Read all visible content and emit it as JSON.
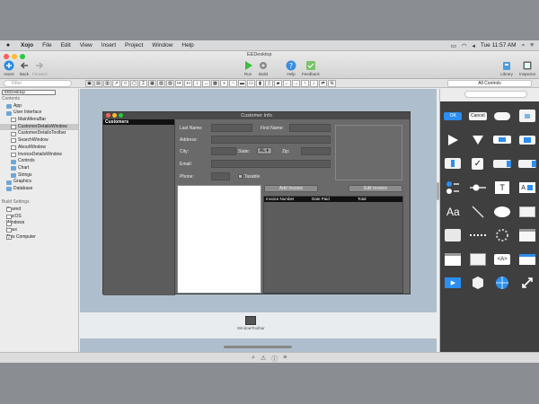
{
  "menubar": {
    "apple": "",
    "items": [
      "Xojo",
      "File",
      "Edit",
      "View",
      "Insert",
      "Project",
      "Window",
      "Help"
    ],
    "clock": "Tue 11:57 AM"
  },
  "window": {
    "tab_title": "EEDesktop",
    "toolbar": {
      "insert": "Insert",
      "back": "Back",
      "forward": "Forward",
      "run": "Run",
      "build": "Build",
      "help": "Help",
      "feedback": "Feedback",
      "library": "Library",
      "inspector": "Inspector"
    },
    "filter_placeholder": "Filter"
  },
  "navigator": {
    "rows": [
      {
        "label": "EEDesktop",
        "type": "hdrbox",
        "indent": 0
      },
      {
        "label": "Contents",
        "type": "header",
        "indent": 0
      },
      {
        "label": "App",
        "type": "folder",
        "indent": 1
      },
      {
        "label": "User Interface",
        "type": "folder",
        "indent": 1
      },
      {
        "label": "MainMenuBar",
        "type": "win",
        "indent": 2
      },
      {
        "label": "CustomerDetailsWindow",
        "type": "win",
        "indent": 2,
        "selected": true
      },
      {
        "label": "CustomerDetailsToolbar",
        "type": "win",
        "indent": 2
      },
      {
        "label": "SearchWindow",
        "type": "win",
        "indent": 2
      },
      {
        "label": "AboutWindow",
        "type": "win",
        "indent": 2
      },
      {
        "label": "InvoiceDetailsWindow",
        "type": "win",
        "indent": 2
      },
      {
        "label": "Controls",
        "type": "folder",
        "indent": 2
      },
      {
        "label": "Chart",
        "type": "folder",
        "indent": 2
      },
      {
        "label": "Strings",
        "type": "folder",
        "indent": 2
      },
      {
        "label": "Graphics",
        "type": "folder",
        "indent": 1
      },
      {
        "label": "Database",
        "type": "folder",
        "indent": 1
      },
      {
        "label": "",
        "type": "spacer",
        "indent": 0
      },
      {
        "label": "Build Settings",
        "type": "header",
        "indent": 0
      },
      {
        "label": "Shared",
        "type": "chk",
        "indent": 1
      },
      {
        "label": "macOS",
        "type": "chk",
        "indent": 1
      },
      {
        "label": "Windows",
        "type": "chk",
        "indent": 1
      },
      {
        "label": "Linux",
        "type": "chk",
        "indent": 1
      },
      {
        "label": "This Computer",
        "type": "chk",
        "indent": 1,
        "checked": true
      }
    ]
  },
  "designer": {
    "window_title": "Customer Info",
    "list_header": "Customers",
    "labels": {
      "last_name": "Last Name:",
      "first_name": "First Name:",
      "address": "Address:",
      "city": "City:",
      "state": "State:",
      "zip": "Zip:",
      "email": "Email:",
      "phone": "Phone:",
      "taxable": "Taxable"
    },
    "state_value": "AL",
    "add_invoice": "Add Invoice",
    "edit_invoice": "Edit Invoice",
    "invoice_columns": [
      "Invoice Number",
      "Date Paid",
      "Total"
    ],
    "tray_item": "WindowToolbar"
  },
  "library": {
    "filter": "All Controls",
    "items": [
      "ok-button",
      "cancel-button",
      "rounded-button",
      "bevel-button",
      "play-button",
      "disclosure-triangle",
      "segmented-control",
      "toggle-button",
      "up-down-arrows",
      "checkbox",
      "popup-menu",
      "combo-box",
      "radio-group",
      "slider",
      "text-field",
      "label-text-field",
      "label",
      "line",
      "oval",
      "rectangle",
      "placard",
      "separator",
      "progress",
      "canvas",
      "list-box",
      "group-box",
      "html-viewer",
      "image-well",
      "movie-player",
      "container",
      "web-viewer",
      "scroll-arrows"
    ]
  }
}
